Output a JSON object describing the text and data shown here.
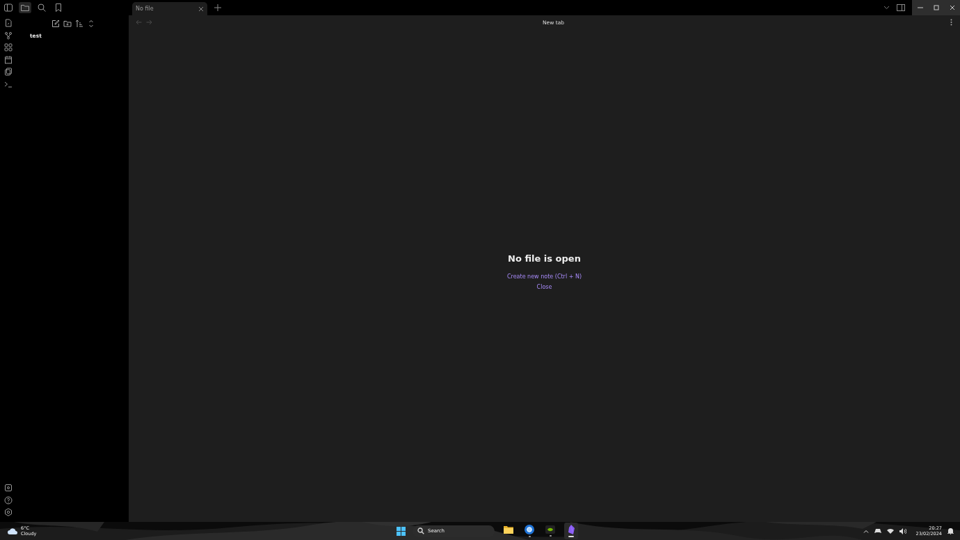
{
  "sidebar_tabs": [
    {
      "kind": "files",
      "selected": true
    },
    {
      "kind": "search",
      "selected": false
    },
    {
      "kind": "bookmarks",
      "selected": false
    }
  ],
  "tabs": [
    {
      "title": "No file",
      "selected": true
    }
  ],
  "view_header": {
    "title": "New tab",
    "can_go_back": false,
    "can_go_forward": false
  },
  "file_tree": [
    {
      "name": "test"
    }
  ],
  "empty_state": {
    "title": "No file is open",
    "actions": [
      "Create new note (Ctrl + N)",
      "Close"
    ]
  },
  "taskbar": {
    "weather": {
      "temperature": "6°C",
      "condition": "Cloudy"
    },
    "search": {
      "placeholder": "Search"
    },
    "apps": [
      {
        "kind": "folder",
        "running": false,
        "active": false
      },
      {
        "kind": "browser",
        "running": true,
        "active": false
      },
      {
        "kind": "gpu",
        "running": true,
        "active": false
      },
      {
        "kind": "notes",
        "running": true,
        "active": true
      }
    ],
    "time": "20:27",
    "date": "23/02/2024"
  }
}
